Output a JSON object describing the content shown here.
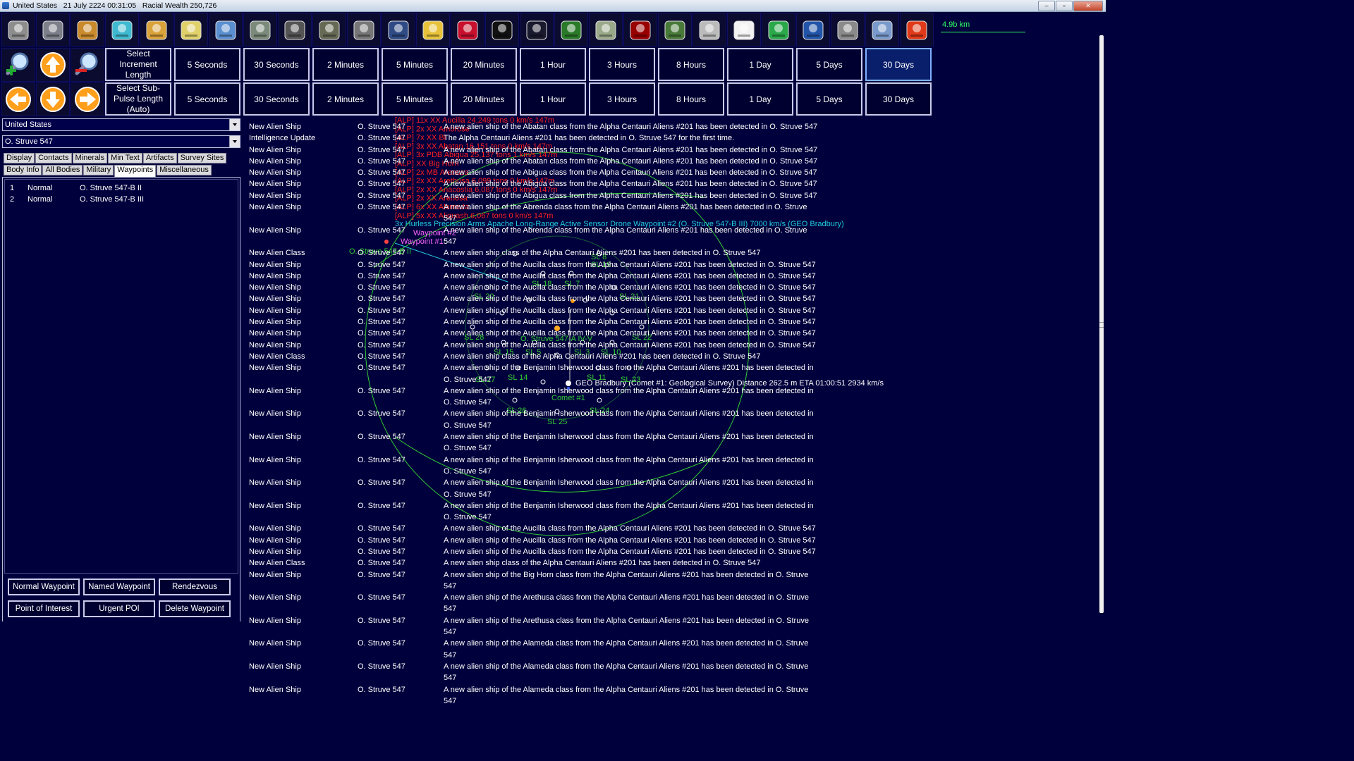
{
  "window": {
    "title": "United States   21 July 2224 00:31:05   Racial Wealth 250,726",
    "controls": [
      "–",
      "▫",
      "✕"
    ]
  },
  "toolbar": {
    "icons": [
      "colony-icon",
      "industry-icon",
      "mining-icon",
      "research-icon",
      "wealth-icon",
      "ship-design-icon",
      "fleet-orders-icon",
      "class-design-icon",
      "missile-design-icon",
      "ground-unit-icon",
      "ground-force-icon",
      "commanders-icon",
      "medals-icon",
      "race-info-icon",
      "system-map-icon",
      "galactic-map-icon",
      "planet-icon",
      "alien-races-icon",
      "intelligence-icon",
      "economy-icon",
      "government-icon",
      "calendar-icon",
      "refresh-icon",
      "save-icon",
      "settings-icon",
      "sm-mode-icon",
      "end-turn-icon"
    ]
  },
  "map": {
    "scale_label": "4.9b km",
    "labels": {
      "fleet_label": "GEO Bradbury  (Comet #1: Geological Survey)  Distance 262.5 m   ETA 01:00:51   2934 km/s",
      "sensor_label": "3x Hurless Precision Arms Apache Long-Range Active Sensor Drone  Waypoint #2  (O. Struve 547-B III)  7000 km/s (GEO Bradbury)",
      "waypoint_2": "Waypoint #2",
      "waypoint_1": "Waypoint #1",
      "body_label": "O. Struve 547-A IV-V",
      "comet_label": "Comet #1",
      "overlap_label": "O. Struve 547-B II",
      "red_contacts": [
        "[ALP]  11x XX Aucilla  24,249 tons   0 km/s  147m",
        "[ALP]  2x XX Ambrose",
        "[ALP]  7x XX Bi",
        "[ALP]  3x XX Abatan  16,151 tons  0 km/s  147m",
        "[ALP]  3x PDB Abigua  25,137 tons  1 km/s  147m",
        "[ALP]  XX Big Horn",
        "[ALP]  2x MB Arenosa",
        "[ALP]  2x XX Arethusa  6,099 tons  0 km/s  147m",
        "[ALP]  2x XX Anacostia  6,087 tons   0 km/s  147m",
        "[ALP]  2x XX Arenosa",
        "[ALP]  6x XX Alameda",
        "[ALP]  5x XX Aliquash  6,067 tons  0 km/s  147m"
      ],
      "sl": [
        "SL 18",
        "SL 7",
        "SL 20",
        "SL 21",
        "SL 28",
        "SL 22",
        "SL 15",
        "SL 5",
        "SL 3",
        "SL 10",
        "SL 27",
        "SL 14",
        "SL 11",
        "SL 23",
        "SL 26",
        "SL 24",
        "SL 25",
        "SL 19",
        "SL 8"
      ]
    }
  },
  "nav": {
    "zoom_in_icon": "zoom-in-icon",
    "zoom_out_icon": "zoom-out-icon",
    "up_icon": "arrow-up-icon",
    "down_icon": "arrow-down-icon",
    "left_icon": "arrow-left-icon",
    "right_icon": "arrow-right-icon"
  },
  "increment": {
    "label": "Select Increment Length",
    "buttons": [
      "5 Seconds",
      "30 Seconds",
      "2 Minutes",
      "5 Minutes",
      "20 Minutes",
      "1 Hour",
      "3 Hours",
      "8 Hours",
      "1 Day",
      "5 Days",
      "30 Days"
    ],
    "selected": "30 Days"
  },
  "subpulse": {
    "label": "Select Sub-Pulse Length (Auto)",
    "buttons": [
      "5 Seconds",
      "30 Seconds",
      "2 Minutes",
      "5 Minutes",
      "20 Minutes",
      "1 Hour",
      "3 Hours",
      "8 Hours",
      "1 Day",
      "5 Days",
      "30 Days"
    ]
  },
  "sidebar": {
    "race_select": "United States",
    "system_select": "O. Struve 547",
    "tabs_row1": [
      "Display",
      "Contacts",
      "Minerals",
      "Min Text",
      "Artifacts",
      "Survey Sites"
    ],
    "tabs_row2": [
      "Body Info",
      "All Bodies",
      "Military",
      "Waypoints",
      "Miscellaneous"
    ],
    "active_tab": "Waypoints",
    "waypoints": [
      {
        "num": "1",
        "type": "Normal",
        "location": "O. Struve 547-B II"
      },
      {
        "num": "2",
        "type": "Normal",
        "location": "O. Struve 547-B III"
      }
    ],
    "buttons": [
      "Normal Waypoint",
      "Named Waypoint",
      "Rendezvous",
      "Point of Interest",
      "Urgent POI",
      "Delete Waypoint"
    ]
  },
  "event_log": [
    {
      "type": "New Alien Ship",
      "system": "O. Struve 547",
      "text": "A new alien ship of the Abatan class from the Alpha Centauri Aliens #201 has been detected in O. Struve 547"
    },
    {
      "type": "Intelligence Update",
      "system": "O. Struve 547",
      "text": "The Alpha Centauri Aliens #201 has been detected in O. Struve 547 for the first time."
    },
    {
      "type": "New Alien Ship",
      "system": "O. Struve 547",
      "text": "A new alien ship of the Abatan class from the Alpha Centauri Aliens #201 has been detected in O. Struve 547"
    },
    {
      "type": "New Alien Ship",
      "system": "O. Struve 547",
      "text": "A new alien ship of the Abatan class from the Alpha Centauri Aliens #201 has been detected in O. Struve 547"
    },
    {
      "type": "New Alien Ship",
      "system": "O. Struve 547",
      "text": "A new alien ship of the Abigua class from the Alpha Centauri Aliens #201 has been detected in O. Struve 547"
    },
    {
      "type": "New Alien Ship",
      "system": "O. Struve 547",
      "text": "A new alien ship of the Abigua class from the Alpha Centauri Aliens #201 has been detected in O. Struve 547"
    },
    {
      "type": "New Alien Ship",
      "system": "O. Struve 547",
      "text": "A new alien ship of the Abigua class from the Alpha Centauri Aliens #201 has been detected in O. Struve 547"
    },
    {
      "type": "New Alien Ship",
      "system": "O. Struve 547",
      "text": "A new alien ship of the Abrenda class from the Alpha Centauri Aliens #201 has been detected in O. Struve 547"
    },
    {
      "type": "New Alien Ship",
      "system": "O. Struve 547",
      "text": "A new alien ship of the Abrenda class from the Alpha Centauri Aliens #201 has been detected in O. Struve 547"
    },
    {
      "type": "New Alien Class",
      "system": "O. Struve 547",
      "text": "A new alien ship class of the Alpha Centauri Aliens #201 has been detected in O. Struve 547"
    },
    {
      "type": "New Alien Ship",
      "system": "O. Struve 547",
      "text": "A new alien ship of the Aucilla class from the Alpha Centauri Aliens #201 has been detected in O. Struve 547"
    },
    {
      "type": "New Alien Ship",
      "system": "O. Struve 547",
      "text": "A new alien ship of the Aucilla class from the Alpha Centauri Aliens #201 has been detected in O. Struve 547"
    },
    {
      "type": "New Alien Ship",
      "system": "O. Struve 547",
      "text": "A new alien ship of the Aucilla class from the Alpha Centauri Aliens #201 has been detected in O. Struve 547"
    },
    {
      "type": "New Alien Ship",
      "system": "O. Struve 547",
      "text": "A new alien ship of the Aucilla class from the Alpha Centauri Aliens #201 has been detected in O. Struve 547"
    },
    {
      "type": "New Alien Ship",
      "system": "O. Struve 547",
      "text": "A new alien ship of the Aucilla class from the Alpha Centauri Aliens #201 has been detected in O. Struve 547"
    },
    {
      "type": "New Alien Ship",
      "system": "O. Struve 547",
      "text": "A new alien ship of the Aucilla class from the Alpha Centauri Aliens #201 has been detected in O. Struve 547"
    },
    {
      "type": "New Alien Ship",
      "system": "O. Struve 547",
      "text": "A new alien ship of the Aucilla class from the Alpha Centauri Aliens #201 has been detected in O. Struve 547"
    },
    {
      "type": "New Alien Ship",
      "system": "O. Struve 547",
      "text": "A new alien ship of the Aucilla class from the Alpha Centauri Aliens #201 has been detected in O. Struve 547"
    },
    {
      "type": "New Alien Class",
      "system": "O. Struve 547",
      "text": "A new alien ship class of the Alpha Centauri Aliens #201 has been detected in O. Struve 547"
    },
    {
      "type": "New Alien Ship",
      "system": "O. Struve 547",
      "text": "A new alien ship of the Benjamin Isherwood class from the Alpha Centauri Aliens #201 has been detected in O. Struve 547"
    },
    {
      "type": "New Alien Ship",
      "system": "O. Struve 547",
      "text": "A new alien ship of the Benjamin Isherwood class from the Alpha Centauri Aliens #201 has been detected in O. Struve 547"
    },
    {
      "type": "New Alien Ship",
      "system": "O. Struve 547",
      "text": "A new alien ship of the Benjamin Isherwood class from the Alpha Centauri Aliens #201 has been detected in O. Struve 547"
    },
    {
      "type": "New Alien Ship",
      "system": "O. Struve 547",
      "text": "A new alien ship of the Benjamin Isherwood class from the Alpha Centauri Aliens #201 has been detected in O. Struve 547"
    },
    {
      "type": "New Alien Ship",
      "system": "O. Struve 547",
      "text": "A new alien ship of the Benjamin Isherwood class from the Alpha Centauri Aliens #201 has been detected in O. Struve 547"
    },
    {
      "type": "New Alien Ship",
      "system": "O. Struve 547",
      "text": "A new alien ship of the Benjamin Isherwood class from the Alpha Centauri Aliens #201 has been detected in O. Struve 547"
    },
    {
      "type": "New Alien Ship",
      "system": "O. Struve 547",
      "text": "A new alien ship of the Benjamin Isherwood class from the Alpha Centauri Aliens #201 has been detected in O. Struve 547"
    },
    {
      "type": "New Alien Ship",
      "system": "O. Struve 547",
      "text": "A new alien ship of the Aucilla class from the Alpha Centauri Aliens #201 has been detected in O. Struve 547"
    },
    {
      "type": "New Alien Ship",
      "system": "O. Struve 547",
      "text": "A new alien ship of the Aucilla class from the Alpha Centauri Aliens #201 has been detected in O. Struve 547"
    },
    {
      "type": "New Alien Ship",
      "system": "O. Struve 547",
      "text": "A new alien ship of the Aucilla class from the Alpha Centauri Aliens #201 has been detected in O. Struve 547"
    },
    {
      "type": "New Alien Class",
      "system": "O. Struve 547",
      "text": "A new alien ship class of the Alpha Centauri Aliens #201 has been detected in O. Struve 547"
    },
    {
      "type": "New Alien Ship",
      "system": "O. Struve 547",
      "text": "A new alien ship of the Big Horn class from the Alpha Centauri Aliens #201 has been detected in O. Struve 547"
    },
    {
      "type": "New Alien Ship",
      "system": "O. Struve 547",
      "text": "A new alien ship of the Arethusa class from the Alpha Centauri Aliens #201 has been detected in O. Struve 547"
    },
    {
      "type": "New Alien Ship",
      "system": "O. Struve 547",
      "text": "A new alien ship of the Arethusa class from the Alpha Centauri Aliens #201 has been detected in O. Struve 547"
    },
    {
      "type": "New Alien Ship",
      "system": "O. Struve 547",
      "text": "A new alien ship of the Alameda class from the Alpha Centauri Aliens #201 has been detected in O. Struve 547"
    },
    {
      "type": "New Alien Ship",
      "system": "O. Struve 547",
      "text": "A new alien ship of the Alameda class from the Alpha Centauri Aliens #201 has been detected in O. Struve 547"
    },
    {
      "type": "New Alien Ship",
      "system": "O. Struve 547",
      "text": "A new alien ship of the Alameda class from the Alpha Centauri Aliens #201 has been detected in O. Struve 547"
    }
  ],
  "colors": {
    "background": "#00003c",
    "map_green": "#33cc33",
    "contact_red": "#ff2020",
    "fleet_cyan": "#22ccdd",
    "waypoint_magenta": "#ff66ff"
  }
}
